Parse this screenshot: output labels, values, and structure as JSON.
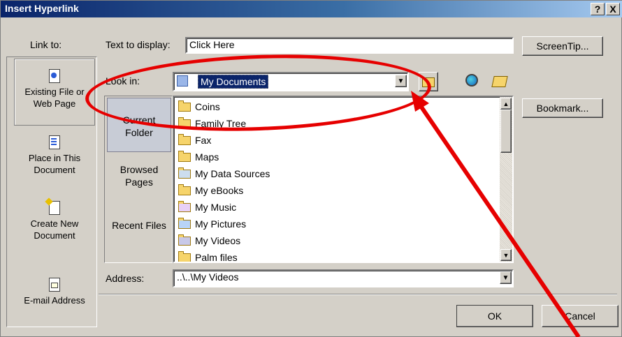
{
  "window": {
    "title": "Insert Hyperlink",
    "help_label": "?",
    "close_label": "X"
  },
  "link_to": {
    "label": "Link to:",
    "items": [
      {
        "label": "Existing File or Web Page",
        "icon": "globe-document-icon",
        "active": true
      },
      {
        "label": "Place in This Document",
        "icon": "document-arrow-icon"
      },
      {
        "label": "Create New Document",
        "icon": "new-document-icon"
      },
      {
        "label": "E-mail Address",
        "icon": "email-document-icon"
      }
    ]
  },
  "text_to_display": {
    "label": "Text to display:",
    "value": "Click Here"
  },
  "screentip_button": "ScreenTip...",
  "look_in": {
    "label": "Look in:",
    "value": "My Documents"
  },
  "nav_buttons": [
    {
      "label": "Current Folder",
      "active": true
    },
    {
      "label": "Browsed Pages"
    },
    {
      "label": "Recent Files"
    }
  ],
  "file_list": [
    {
      "name": "Coins",
      "icon": "folder-icon"
    },
    {
      "name": "Family Tree",
      "icon": "folder-icon"
    },
    {
      "name": "Fax",
      "icon": "folder-icon"
    },
    {
      "name": "Maps",
      "icon": "folder-icon"
    },
    {
      "name": "My Data Sources",
      "icon": "data-sources-folder-icon"
    },
    {
      "name": "My eBooks",
      "icon": "folder-icon"
    },
    {
      "name": "My Music",
      "icon": "music-folder-icon"
    },
    {
      "name": "My Pictures",
      "icon": "pictures-folder-icon"
    },
    {
      "name": "My Videos",
      "icon": "videos-folder-icon"
    },
    {
      "name": "Palm files",
      "icon": "folder-icon"
    }
  ],
  "bookmark_button": "Bookmark...",
  "address": {
    "label": "Address:",
    "value": "..\\..\\My Videos"
  },
  "ok_button": "OK",
  "cancel_button": "Cancel",
  "colors": {
    "annotation": "#e60000",
    "titlebar": "#0a246a",
    "selection": "#0a246a"
  }
}
